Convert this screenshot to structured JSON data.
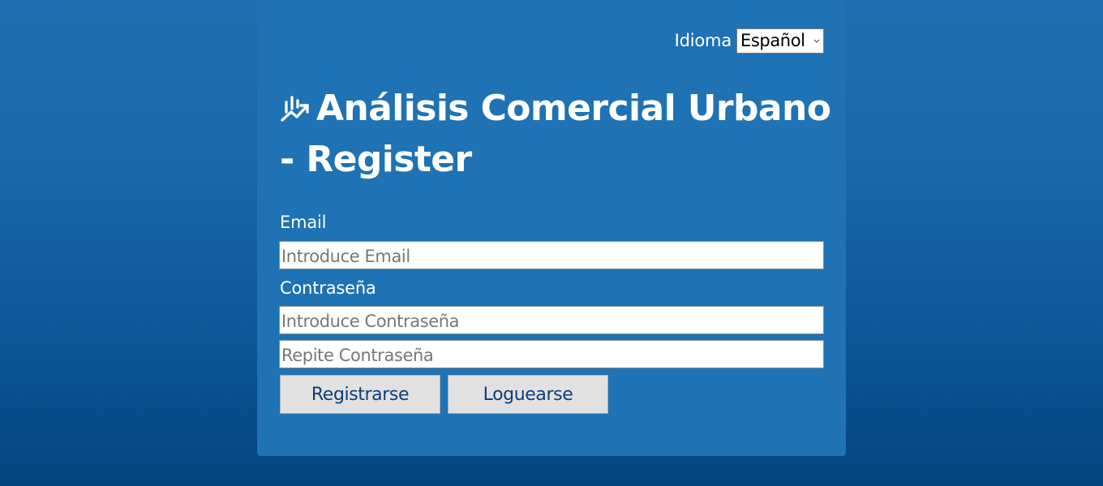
{
  "language": {
    "label": "Idioma",
    "selected": "Español"
  },
  "header": {
    "title": "Análisis Comercial Urbano - Register"
  },
  "form": {
    "email_label": "Email",
    "email_placeholder": "Introduce Email",
    "password_label": "Contraseña",
    "password_placeholder": "Introduce Contraseña",
    "repeat_password_placeholder": "Repite Contraseña",
    "register_button": "Registrarse",
    "login_button": "Loguearse"
  },
  "colors": {
    "background_top": "#1e70b2",
    "background_bottom": "#03447f",
    "card": "#1f72b3",
    "button": "#e1e1e1",
    "button_text": "#0b3f7a"
  }
}
